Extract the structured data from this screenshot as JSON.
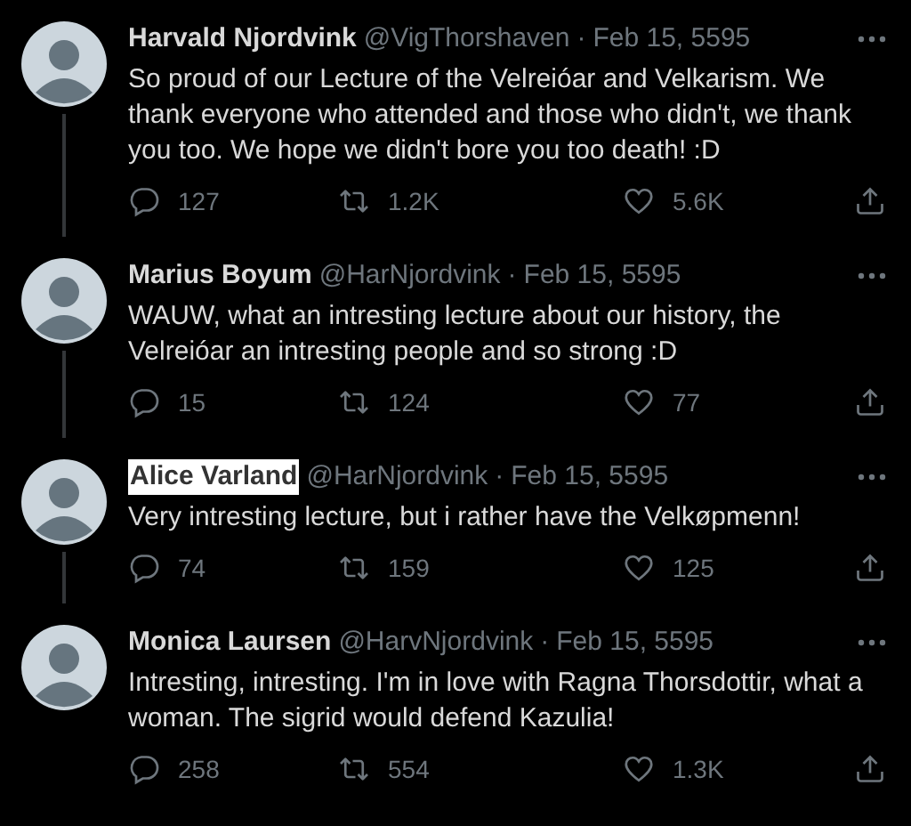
{
  "tweets": [
    {
      "name": "Harvald Njordvink",
      "name_highlighted": false,
      "handle": "@VigThorshaven",
      "separator": "·",
      "date": "Feb 15, 5595",
      "text": "So proud of our Lecture of the Velreióar and Velkarism. We thank everyone who attended and those who didn't, we thank you too. We hope we didn't bore you too death! :D",
      "replies": "127",
      "retweets": "1.2K",
      "likes": "5.6K",
      "thread": true
    },
    {
      "name": "Marius Boyum",
      "name_highlighted": false,
      "handle": "@HarNjordvink",
      "separator": "·",
      "date": "Feb 15, 5595",
      "text": "WAUW, what an intresting lecture about our history, the Velreióar an intresting people and so strong :D",
      "replies": "15",
      "retweets": "124",
      "likes": "77",
      "thread": true
    },
    {
      "name": "Alice Varland",
      "name_highlighted": true,
      "handle": "@HarNjordvink",
      "separator": "·",
      "date": "Feb 15, 5595",
      "text": "Very intresting lecture, but i rather have the Velkøpmenn!",
      "replies": "74",
      "retweets": "159",
      "likes": "125",
      "thread": true
    },
    {
      "name": "Monica Laursen",
      "name_highlighted": false,
      "handle": "@HarvNjordvink",
      "separator": "·",
      "date": "Feb 15, 5595",
      "text": "Intresting, intresting. I'm in love with Ragna Thorsdottir, what a woman. The sigrid would defend Kazulia!",
      "replies": "258",
      "retweets": "554",
      "likes": "1.3K",
      "thread": false
    }
  ]
}
